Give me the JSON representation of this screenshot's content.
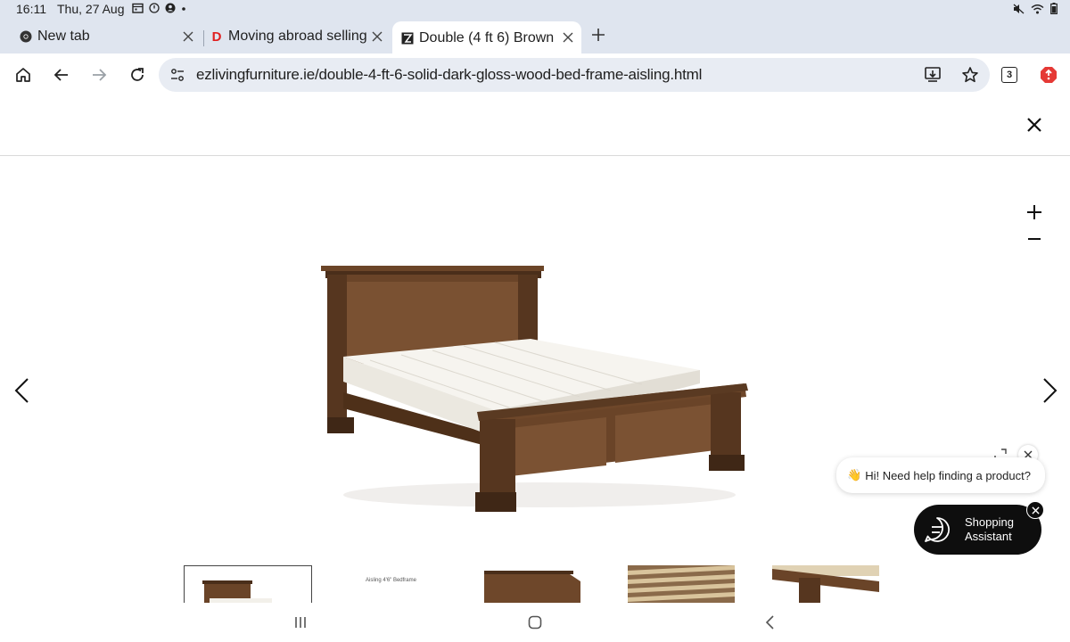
{
  "status_bar": {
    "time": "16:11",
    "date": "Thu, 27 Aug"
  },
  "tabs": [
    {
      "title": "New tab",
      "favicon": "chrome-icon",
      "active": false
    },
    {
      "title": "Moving abroad selling",
      "favicon": "D",
      "favicon_color": "#e02020",
      "active": false
    },
    {
      "title": "Double (4 ft 6) Brown",
      "favicon": "ez-living-icon",
      "active": true
    }
  ],
  "toolbar": {
    "url": "ezlivingfurniture.ie/double-4-ft-6-solid-dark-gloss-wood-bed-frame-aisling.html",
    "tab_count": "3"
  },
  "gallery": {
    "thumbnail_caption": "Aisling 4'6\" Bedframe",
    "thumbnail_count": 5,
    "selected_thumbnail": 1
  },
  "chat": {
    "greeting": "Hi! Need help finding a product?",
    "assistant_label_line1": "Shopping",
    "assistant_label_line2": "Assistant"
  },
  "colors": {
    "chrome_bg": "#dfe5ef",
    "omnibox_bg": "#e8ecf3",
    "wood": "#5b3a22",
    "assistant_bg": "#0e0e0e"
  }
}
